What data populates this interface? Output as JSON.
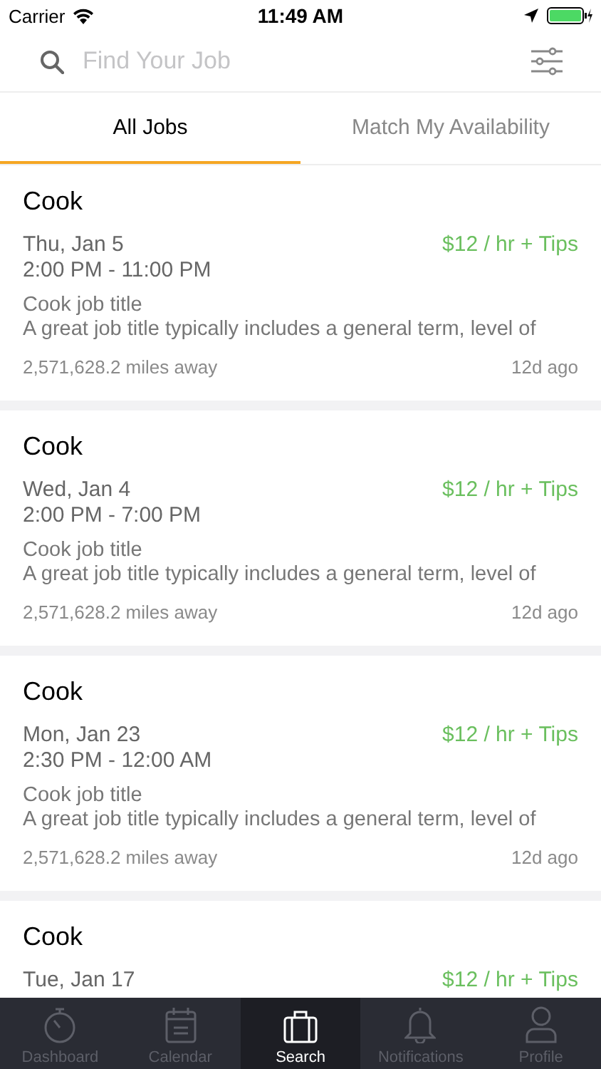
{
  "status_bar": {
    "carrier": "Carrier",
    "time": "11:49 AM"
  },
  "search": {
    "placeholder": "Find Your Job"
  },
  "tabs": [
    {
      "label": "All Jobs",
      "selected": true
    },
    {
      "label": "Match My Availability",
      "selected": false
    }
  ],
  "jobs": [
    {
      "title": "Cook",
      "date": "Thu, Jan 5",
      "time": "2:00 PM - 11:00 PM",
      "pay": "$12 / hr + Tips",
      "job_title": "Cook job title",
      "description": "A great job title typically includes a general term, level of",
      "distance": "2,571,628.2 miles away",
      "posted": "12d ago"
    },
    {
      "title": "Cook",
      "date": "Wed, Jan 4",
      "time": "2:00 PM - 7:00 PM",
      "pay": "$12 / hr + Tips",
      "job_title": "Cook job title",
      "description": "A great job title typically includes a general term, level of",
      "distance": "2,571,628.2 miles away",
      "posted": "12d ago"
    },
    {
      "title": "Cook",
      "date": "Mon, Jan 23",
      "time": "2:30 PM - 12:00 AM",
      "pay": "$12 / hr + Tips",
      "job_title": "Cook job title",
      "description": "A great job title typically includes a general term, level of",
      "distance": "2,571,628.2 miles away",
      "posted": "12d ago"
    },
    {
      "title": "Cook",
      "date": "Tue, Jan 17",
      "pay": "$12 / hr + Tips"
    }
  ],
  "tab_bar": [
    {
      "kind": "stopwatch",
      "label": "Dashboard",
      "selected": false
    },
    {
      "kind": "calendar",
      "label": "Calendar",
      "selected": false
    },
    {
      "kind": "briefcase",
      "label": "Search",
      "selected": true
    },
    {
      "kind": "bell",
      "label": "Notifications",
      "selected": false
    },
    {
      "kind": "person",
      "label": "Profile",
      "selected": false
    }
  ]
}
